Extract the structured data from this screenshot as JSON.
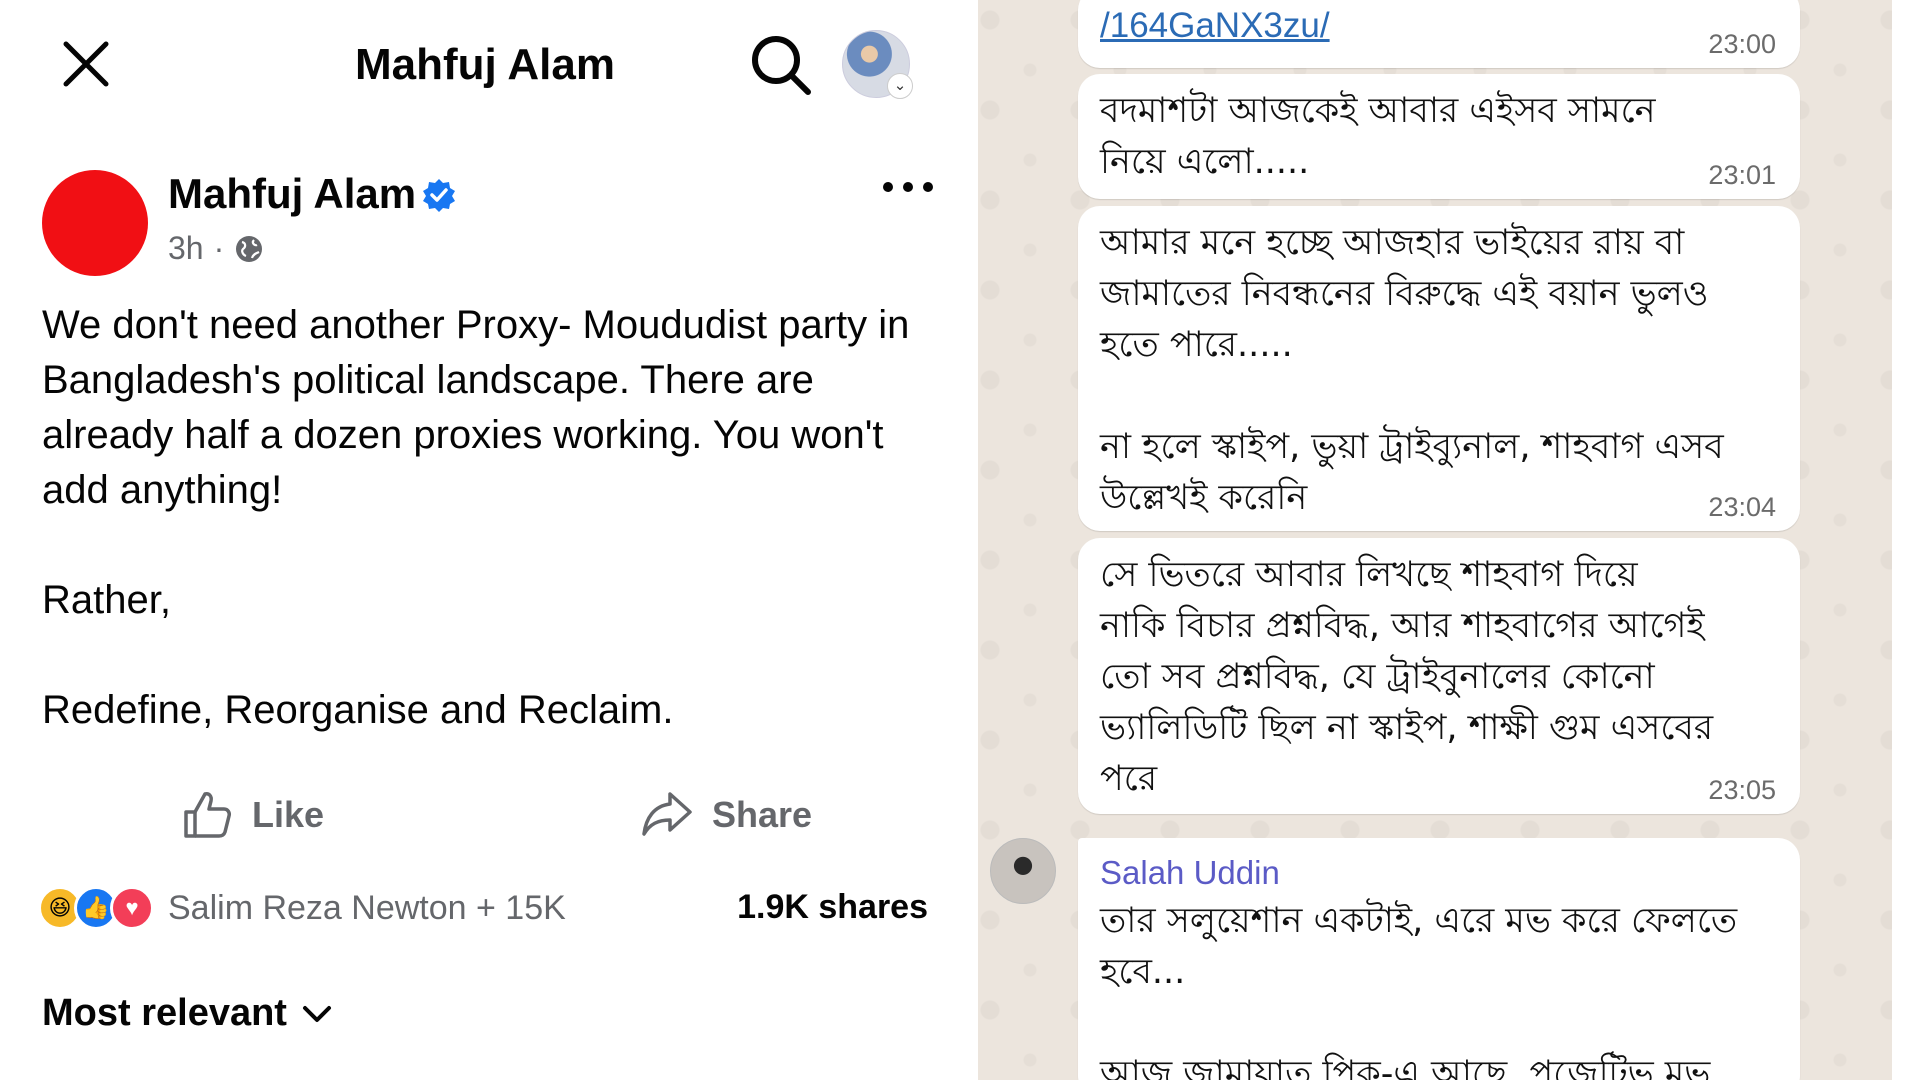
{
  "facebook": {
    "header": {
      "title": "Mahfuj Alam",
      "close_icon": "close-icon",
      "search_icon": "search-icon"
    },
    "post": {
      "author": "Mahfuj Alam",
      "verified": true,
      "time": "3h",
      "separator": "·",
      "privacy_icon": "globe-icon",
      "body": [
        "We don't need another Proxy- Moududist party in Bangladesh's political landscape. There are already half a dozen proxies working. You won't add anything!",
        "Rather,",
        "Redefine, Reorganise and Reclaim."
      ]
    },
    "actions": {
      "like_label": "Like",
      "share_label": "Share"
    },
    "reactions": {
      "types": [
        "haha",
        "like",
        "love"
      ],
      "names": "Salim Reza Newton + 15K",
      "shares": "1.9K shares"
    },
    "comments": {
      "sort_label": "Most relevant"
    }
  },
  "whatsapp": {
    "messages": [
      {
        "link": "/164GaNX3zu/",
        "time": "23:00"
      },
      {
        "text": "বদমাশটা আজকেই আবার এইসব সামনে\nনিয়ে এলো.....",
        "time": "23:01"
      },
      {
        "text": "আমার মনে হচ্ছে আজহার ভাইয়ের রায় বা\nজামাতের নিবন্ধনের বিরুদ্ধে  এই বয়ান ভুলও\nহতে পারে.....\n\nনা হলে স্কাইপ, ভুয়া ট্রাইব্যুনাল, শাহবাগ এসব\nউল্লেখই করেনি",
        "time": "23:04"
      },
      {
        "text": "সে ভিতরে আবার লিখছে শাহবাগ দিয়ে\nনাকি বিচার প্রশ্নবিদ্ধ, আর শাহবাগের আগেই\nতো সব প্রশ্নবিদ্ধ,  যে ট্রাইবুনালের কোনো\nভ্যালিডিটি ছিল না স্কাইপ, শাক্ষী গুম এসবের\nপরে",
        "time": "23:05"
      },
      {
        "sender": "Salah Uddin",
        "text": "তার সলুয়েশান একটাই, এরে মভ করে ফেলতে\nহবে...\n\nআজ জামায়াত পিক-এ আছে, পজেটিভ মুভ"
      }
    ],
    "colors": {
      "background": "#ece5dd",
      "bubble": "#ffffff",
      "sender": "#5b5bc6",
      "link": "#2b6bb5"
    }
  }
}
